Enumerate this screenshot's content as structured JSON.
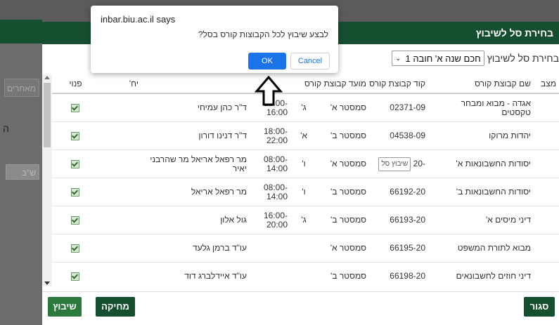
{
  "background": {
    "tab_label": "מאחרים",
    "mark_label": "ה",
    "field_label": "ש\"ב"
  },
  "modal": {
    "title": "בחירת סל לשיבוץ",
    "select_label": "בחירת סל לשיבוץ",
    "select_value": "חכם שנה א' חובה 1",
    "columns": {
      "status": "מצב",
      "group_name": "שם קבוצת קורס",
      "group_code": "קוד קבוצת קורס",
      "group_time": "מועד קבוצת קורס",
      "together": "יח'",
      "free": "פנוי"
    },
    "rows": [
      {
        "name": "אגדה - מבוא ומבחר טקסטים",
        "code": "02371-09",
        "semester": "סמסטר א'",
        "day": "ג'",
        "time": "12:00-16:00",
        "lecturer": "ד\"ר כהן עמיחי"
      },
      {
        "name": "יהדות מרוקו",
        "code": "04538-09",
        "semester": "סמסטר ב'",
        "day": "א'",
        "time": "18:00-22:00",
        "lecturer": "ד\"ר דנינו דורון"
      },
      {
        "name": "יסודות החשבונאות א'",
        "code": "-20",
        "code_input": "שיבוץ סל",
        "semester": "סמסטר א'",
        "day": "ו'",
        "time": "08:00-14:00",
        "lecturer": "מר רפאל אריאל מר שהרבני יאיר"
      },
      {
        "name": "יסודות החשבונאות ב'",
        "code": "66192-20",
        "semester": "סמסטר ב'",
        "day": "ו'",
        "time": "08:00-14:00",
        "lecturer": "מר רפאל אריאל"
      },
      {
        "name": "דיני מיסים א'",
        "code": "66193-20",
        "semester": "סמסטר ב'",
        "day": "ג'",
        "time": "16:00-20:00",
        "lecturer": "גול אלון"
      },
      {
        "name": "מבוא לתורת המשפט",
        "code": "66195-20",
        "semester": "סמסטר א'",
        "day": "",
        "time": "",
        "lecturer": "עו\"ד ברמן גלעד"
      },
      {
        "name": "דיני חוזים לחשבונאים",
        "code": "66198-20",
        "semester": "סמסטר ב'",
        "day": "",
        "time": "",
        "lecturer": "עו\"ד איידלברג דוד"
      }
    ],
    "buttons": {
      "assign": "שיבוץ",
      "delete": "מחיקה",
      "close": "סגור"
    }
  },
  "alert": {
    "title": "inbar.biu.ac.il says",
    "message": "לבצע שיבוץ לכל הקבוצות קורס בסל?",
    "ok_label": "OK",
    "cancel_label": "Cancel"
  },
  "colors": {
    "header_green": "#164f2f",
    "assign_green": "#2c7a3b",
    "alert_blue": "#1a73e8"
  }
}
